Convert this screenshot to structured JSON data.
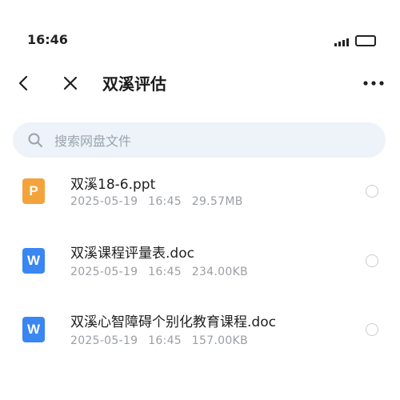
{
  "status_bar": {
    "time": "16:46"
  },
  "nav": {
    "title": "双溪评估"
  },
  "search": {
    "placeholder": "搜索网盘文件",
    "value": ""
  },
  "files": [
    {
      "type": "ppt",
      "icon_letter": "P",
      "name": "双溪18-6.ppt",
      "date": "2025-05-19",
      "time": "16:45",
      "size": "29.57MB"
    },
    {
      "type": "doc",
      "icon_letter": "W",
      "name": "双溪课程评量表.doc",
      "date": "2025-05-19",
      "time": "16:45",
      "size": "234.00KB"
    },
    {
      "type": "doc",
      "icon_letter": "W",
      "name": "双溪心智障碍个别化教育课程.doc",
      "date": "2025-05-19",
      "time": "16:45",
      "size": "157.00KB"
    }
  ],
  "colors": {
    "ppt_icon": "#f4a33c",
    "doc_icon": "#3a86f2",
    "search_bg": "#eef3f9"
  }
}
